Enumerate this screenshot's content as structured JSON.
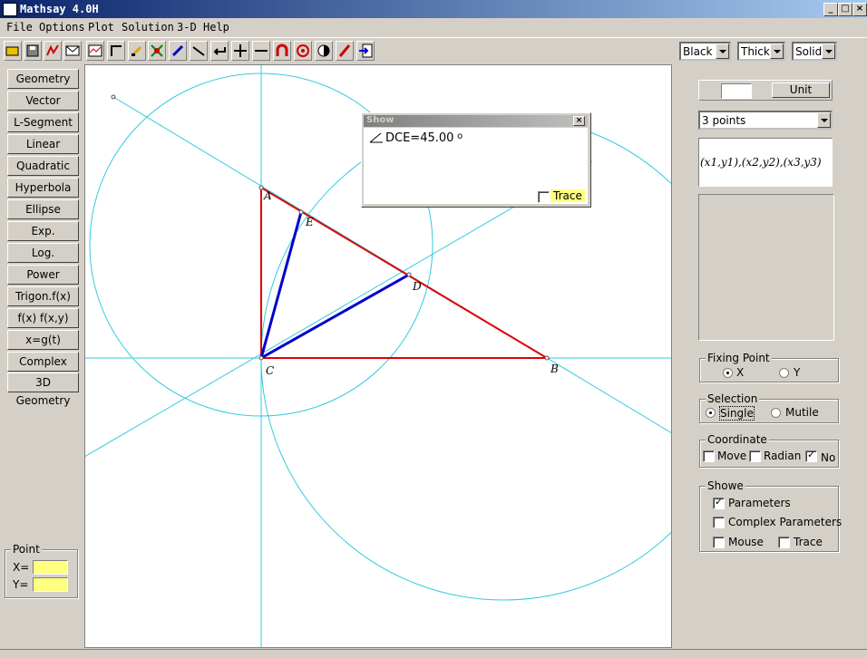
{
  "window": {
    "title": "Mathsay 4.0H",
    "minimize": "_",
    "maximize": "□",
    "close": "×"
  },
  "menu": [
    "File",
    "Options",
    "Plot",
    "Solution",
    "3-D",
    "Help"
  ],
  "style_selectors": {
    "color": "Black",
    "thickness": "Thick",
    "line_style": "Solid"
  },
  "left_buttons": [
    "Geometry",
    "Vector",
    "L-Segment",
    "Linear",
    "Quadratic",
    "Hyperbola",
    "Ellipse",
    "Exp.",
    "Log.",
    "Power",
    "Trigon.f(x)",
    "f(x)  f(x,y)",
    "x=g(t) y=h(t)",
    "Complex",
    "3D Geometry"
  ],
  "point_group": {
    "title": "Point",
    "x_label": "X=",
    "y_label": "Y=",
    "x_value": "",
    "y_value": ""
  },
  "show_window": {
    "title": "Show",
    "measure": "DCE=45.00",
    "degree": "o",
    "trace_label": "Trace"
  },
  "right_panel": {
    "unit_value": "",
    "unit_button": "Unit",
    "points_select": "3 points",
    "formula": "(x1,y1),(x2,y2),(x3,y3)",
    "fixing_point": {
      "title": "Fixing Point",
      "x": "X",
      "y": "Y"
    },
    "selection": {
      "title": "Selection",
      "single": "Single",
      "mutile": "Mutile"
    },
    "coordinate": {
      "title": "Coordinate",
      "move": "Move",
      "radian": "Radian",
      "no": "No"
    },
    "showe": {
      "title": "Showe",
      "parameters": "Parameters",
      "complex_parameters": "Complex Parameters",
      "mouse": "Mouse",
      "trace": "Trace"
    }
  },
  "geometry": {
    "labels": {
      "A": "A",
      "B": "B",
      "C": "C",
      "D": "D",
      "E": "E"
    }
  },
  "colors": {
    "triangle": "#e00000",
    "segments": "#0000cc",
    "construction": "#33ccdd",
    "title_bar": "#0a246a"
  }
}
